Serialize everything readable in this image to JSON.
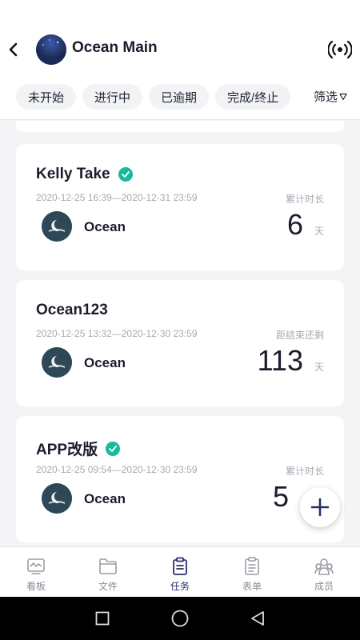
{
  "header": {
    "title": "Ocean Main",
    "back_icon": "chevron-left-icon",
    "broadcast_icon": "broadcast-icon"
  },
  "filters": {
    "chips": [
      "未开始",
      "进行中",
      "已逾期",
      "完成/终止"
    ],
    "filter_label": "筛选"
  },
  "tasks": [
    {
      "title": "Kelly Take",
      "completed": true,
      "dates": "2020-12-25 16:39—2020-12-31 23:59",
      "meta_label": "累计时长",
      "owner": "Ocean",
      "value": "6",
      "unit": "天"
    },
    {
      "title": "Ocean123",
      "completed": false,
      "dates": "2020-12-25 13:32—2020-12-30 23:59",
      "meta_label": "距结束还剩",
      "owner": "Ocean",
      "value": "113",
      "unit": "天"
    },
    {
      "title": "APP改版",
      "completed": true,
      "dates": "2020-12-25 09:54—2020-12-30 23:59",
      "meta_label": "累计时长",
      "owner": "Ocean",
      "value": "5",
      "unit": ""
    }
  ],
  "tabbar": {
    "items": [
      {
        "label": "看板",
        "icon": "dashboard-icon"
      },
      {
        "label": "文件",
        "icon": "folder-icon"
      },
      {
        "label": "任务",
        "icon": "task-clipboard-icon"
      },
      {
        "label": "表单",
        "icon": "form-icon"
      },
      {
        "label": "成员",
        "icon": "members-icon"
      }
    ],
    "active_index": 2
  },
  "colors": {
    "accent": "#27306b",
    "check": "#19b99a",
    "muted": "#a7a9b3"
  }
}
